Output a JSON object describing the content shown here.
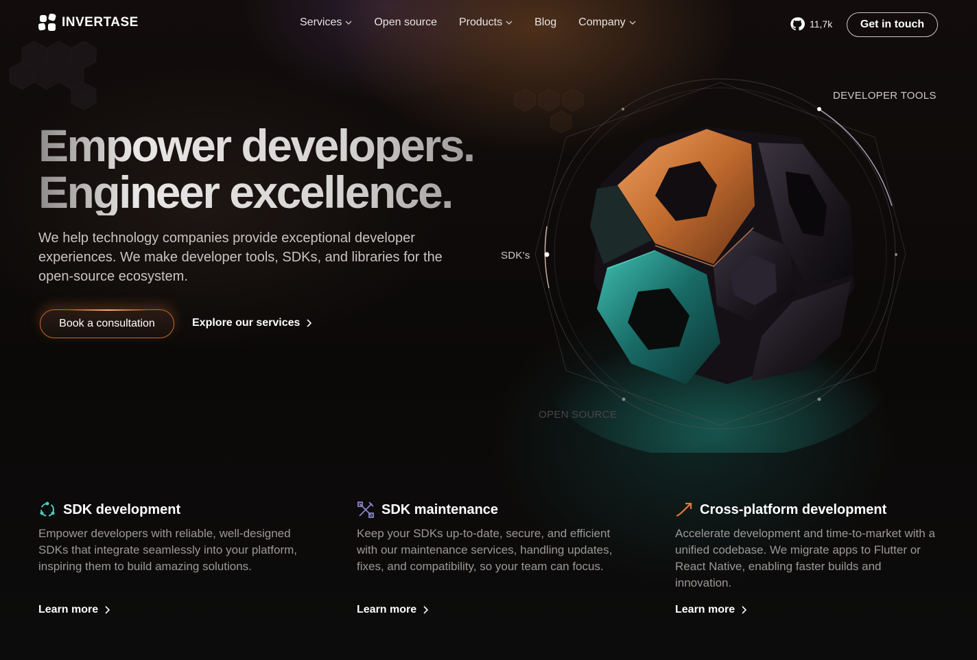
{
  "brand": {
    "name": "INVERTASE"
  },
  "nav": {
    "items": [
      {
        "label": "Services",
        "dropdown": true
      },
      {
        "label": "Open source",
        "dropdown": false
      },
      {
        "label": "Products",
        "dropdown": true
      },
      {
        "label": "Blog",
        "dropdown": false
      },
      {
        "label": "Company",
        "dropdown": true
      }
    ],
    "github_stars": "11,7k",
    "cta_label": "Get in touch"
  },
  "hero": {
    "headline_line1": "Empower developers.",
    "headline_line2": "Engineer excellence.",
    "subtitle": "We help technology companies provide exceptional developer experiences. We make developer tools, SDKs, and libraries for the open-source ecosystem.",
    "primary_cta": "Book a consultation",
    "secondary_cta": "Explore our services"
  },
  "orb": {
    "labels": {
      "developer_tools": "DEVELOPER TOOLS",
      "sdks": "SDK's",
      "open_source": "OPEN SOURCE"
    }
  },
  "features": [
    {
      "icon": "cycle-icon",
      "title": "SDK development",
      "description": "Empower developers with reliable, well-designed SDKs that integrate seamlessly into your platform, inspiring them to build amazing solutions.",
      "link": "Learn more"
    },
    {
      "icon": "tools-icon",
      "title": "SDK maintenance",
      "description": "Keep your SDKs up-to-date, secure, and efficient with our maintenance services, handling updates, fixes, and compatibility, so your team can focus.",
      "link": "Learn more"
    },
    {
      "icon": "trend-arrow-icon",
      "title": "Cross-platform development",
      "description": "Accelerate development and time-to-market with a unified codebase. We migrate apps to Flutter or React Native, enabling faster builds and innovation.",
      "link": "Learn more"
    }
  ],
  "colors": {
    "accent_orange": "#e07a3a",
    "accent_teal": "#2bb5a8",
    "accent_purple": "#8a86c8",
    "background": "#0a0808"
  }
}
